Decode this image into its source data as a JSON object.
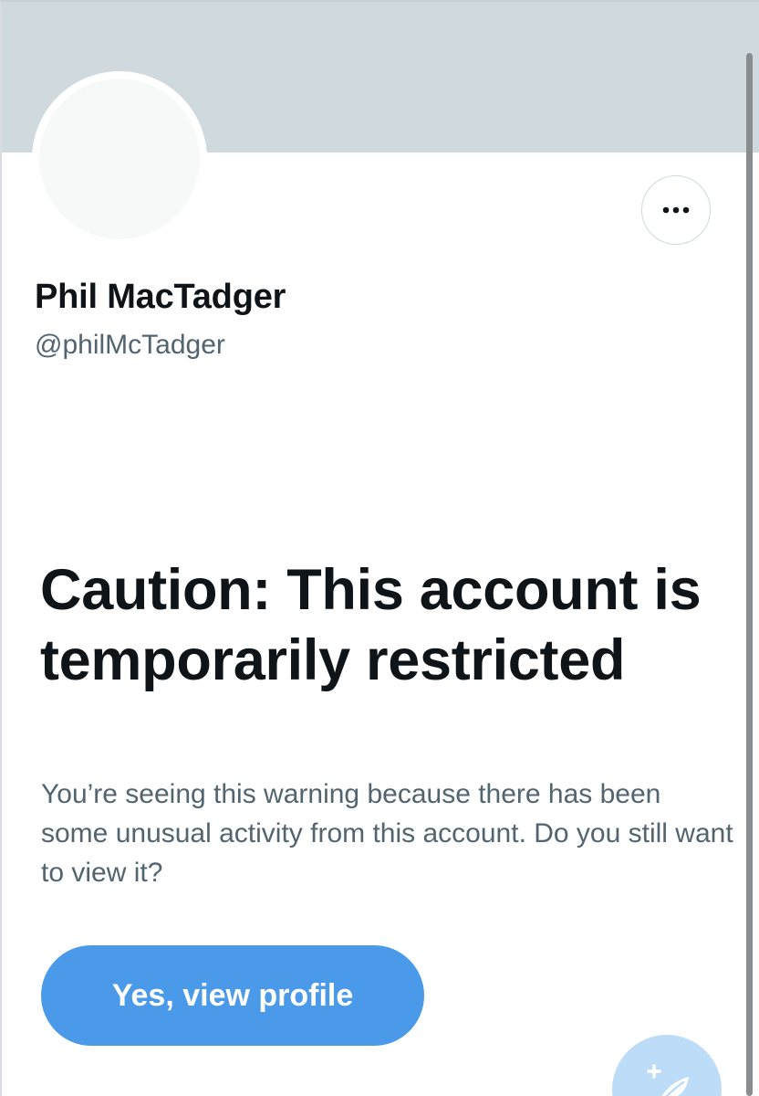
{
  "profile": {
    "display_name": "Phil MacTadger",
    "handle": "@philMcTadger",
    "banner_color": "#cfd9de"
  },
  "more_button": {
    "icon": "ellipsis-icon"
  },
  "warning": {
    "title": "Caution: This account is temporarily restricted",
    "body": "You’re seeing this warning because there has been some unusual activity from this account. Do you still want to view it?",
    "button_label": "Yes, view profile"
  },
  "compose_fab": {
    "icon": "compose-plus-feather-icon"
  },
  "colors": {
    "accent": "#4a9ae9",
    "text_primary": "#0f1419",
    "text_secondary": "#536471"
  }
}
